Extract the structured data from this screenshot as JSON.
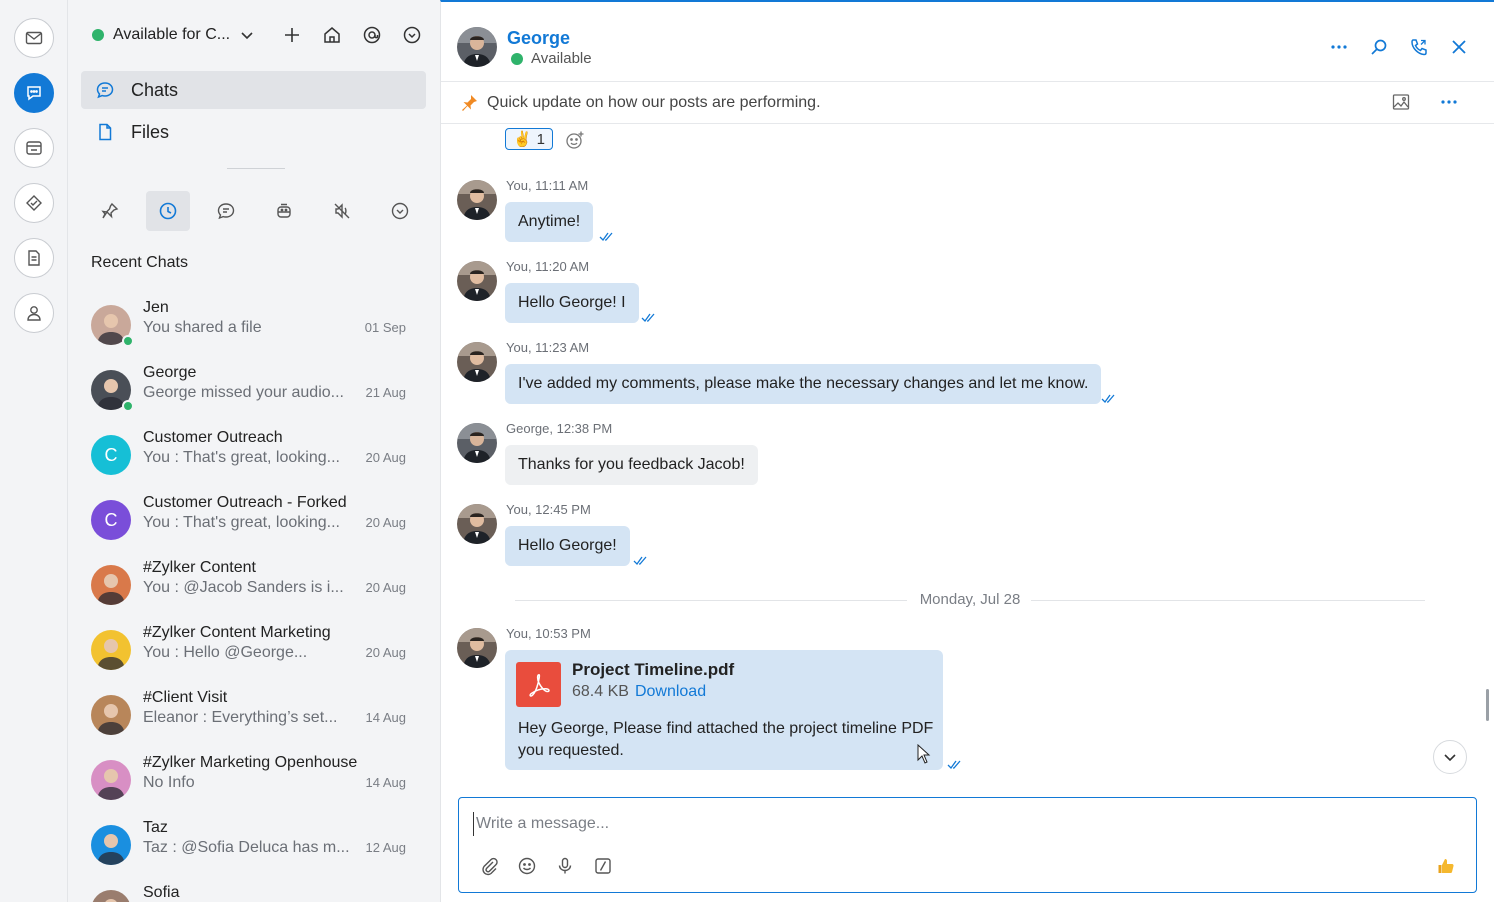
{
  "rail": {
    "items": [
      {
        "name": "mail-icon"
      },
      {
        "name": "chat-icon"
      },
      {
        "name": "contacts-card-icon"
      },
      {
        "name": "tasks-icon"
      },
      {
        "name": "notes-icon"
      },
      {
        "name": "profile-icon"
      }
    ]
  },
  "side": {
    "status_label": "Available for C...",
    "nav": {
      "chats": "Chats",
      "files": "Files"
    },
    "recent_title": "Recent Chats",
    "chats": [
      {
        "name": "Jen",
        "preview": "You shared a file",
        "date": "01 Sep",
        "online": true,
        "avatar_color": "#c9a89a"
      },
      {
        "name": "George",
        "preview": "George missed your audio...",
        "date": "21 Aug",
        "online": true,
        "avatar_color": "#4a4f57"
      },
      {
        "name": "Customer Outreach",
        "preview": "You : That's great, looking...",
        "date": "20 Aug",
        "initial": "C",
        "avatar_color": "#16bfd6"
      },
      {
        "name": "Customer Outreach - Forked",
        "preview": "You : That's great, looking...",
        "date": "20 Aug",
        "initial": "C",
        "avatar_color": "#7a4ed9"
      },
      {
        "name": "#Zylker Content",
        "preview": "You : @Jacob Sanders is i...",
        "date": "20 Aug",
        "avatar_color": "#d9794a"
      },
      {
        "name": "#Zylker Content Marketing",
        "preview": "You : Hello @George...",
        "date": "20 Aug",
        "avatar_color": "#f2c230"
      },
      {
        "name": "#Client Visit",
        "preview": "Eleanor : Everything’s set...",
        "date": "14 Aug",
        "avatar_color": "#b8865a"
      },
      {
        "name": "#Zylker Marketing Openhouse",
        "preview": "No Info",
        "date": "14 Aug",
        "avatar_color": "#d88fc4"
      },
      {
        "name": "Taz",
        "preview": "Taz : @Sofia Deluca has m...",
        "date": "12 Aug",
        "avatar_color": "#1a8fe0"
      },
      {
        "name": "Sofia",
        "preview": "",
        "date": "",
        "avatar_color": "#9a7d6e"
      }
    ]
  },
  "header": {
    "name": "George",
    "status": "Available"
  },
  "pinned": {
    "text": "Quick update on how our posts are performing."
  },
  "reaction": {
    "emoji": "✌️",
    "count": "1"
  },
  "messages": [
    {
      "meta": "You, 11:11 AM",
      "text": "Anytime!"
    },
    {
      "meta": "You, 11:20 AM",
      "text": "Hello George! I"
    },
    {
      "meta": "You, 11:23 AM",
      "text": "I've added my comments, please make the necessary changes and let me know."
    },
    {
      "meta": "George, 12:38 PM",
      "text": "Thanks for you feedback Jacob!"
    },
    {
      "meta": "You, 12:45 PM",
      "text": "Hello George!"
    }
  ],
  "date_separator": "Monday, Jul 28",
  "file_message": {
    "meta": "You, 10:53 PM",
    "file_name": "Project Timeline.pdf",
    "file_size": "68.4 KB",
    "download": "Download",
    "text": "Hey George, Please find attached the project timeline PDF you requested."
  },
  "composer": {
    "placeholder": "Write a message..."
  },
  "colors": {
    "accent": "#1279d6",
    "online": "#2fb36b",
    "bubble_mine": "#d4e4f4",
    "bubble_theirs": "#eef0f2",
    "pdf": "#e94d3d"
  }
}
